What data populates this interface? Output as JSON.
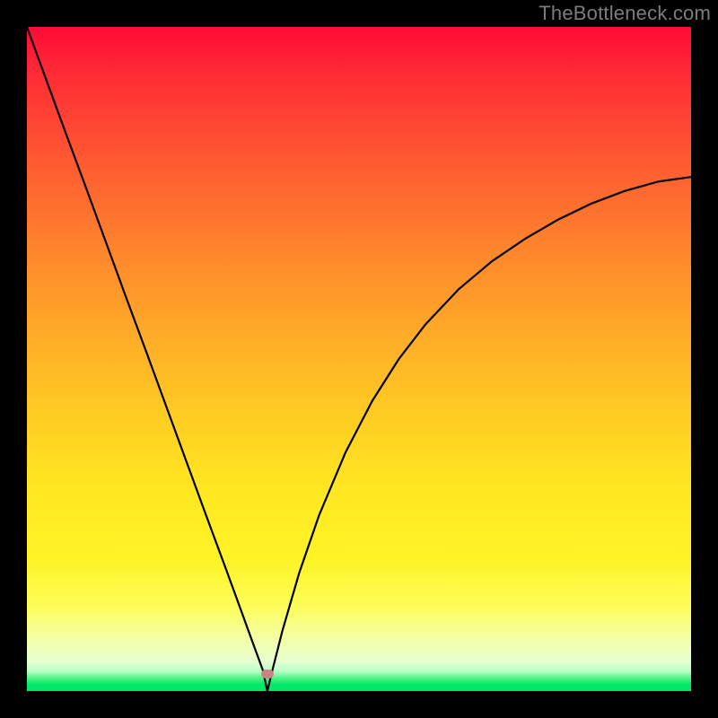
{
  "watermark": "TheBottleneck.com",
  "marker": {
    "x_frac": 0.362,
    "y_frac": 0.974,
    "color": "#c98383"
  },
  "gradient_stops": [
    {
      "pos": 0.0,
      "color": "#ff0b37"
    },
    {
      "pos": 0.5,
      "color": "#ffd022"
    },
    {
      "pos": 0.92,
      "color": "#f4ffa5"
    },
    {
      "pos": 1.0,
      "color": "#00e665"
    }
  ],
  "chart_data": {
    "type": "line",
    "title": "",
    "xlabel": "",
    "ylabel": "",
    "xlim": [
      0,
      1
    ],
    "ylim": [
      0,
      1
    ],
    "note": "V-shaped bottleneck curve. y = 0 at the optimum (x≈0.362), rising steeply on both sides; left branch reaches y≈1 at x=0, right branch asymptotes to y≈0.77 at x=1. x/y in normalized plot-fraction units since the image has no axis ticks.",
    "series": [
      {
        "name": "bottleneck-curve",
        "x": [
          0.0,
          0.03,
          0.06,
          0.09,
          0.12,
          0.15,
          0.18,
          0.21,
          0.24,
          0.27,
          0.3,
          0.32,
          0.34,
          0.355,
          0.362,
          0.37,
          0.385,
          0.41,
          0.44,
          0.48,
          0.52,
          0.56,
          0.6,
          0.65,
          0.7,
          0.75,
          0.8,
          0.85,
          0.9,
          0.95,
          1.0
        ],
        "y": [
          1.0,
          0.918,
          0.836,
          0.755,
          0.673,
          0.591,
          0.51,
          0.428,
          0.346,
          0.264,
          0.183,
          0.128,
          0.073,
          0.032,
          0.0,
          0.033,
          0.092,
          0.178,
          0.265,
          0.36,
          0.437,
          0.5,
          0.552,
          0.605,
          0.647,
          0.681,
          0.71,
          0.734,
          0.753,
          0.767,
          0.774
        ]
      }
    ],
    "optimum_x": 0.362
  }
}
